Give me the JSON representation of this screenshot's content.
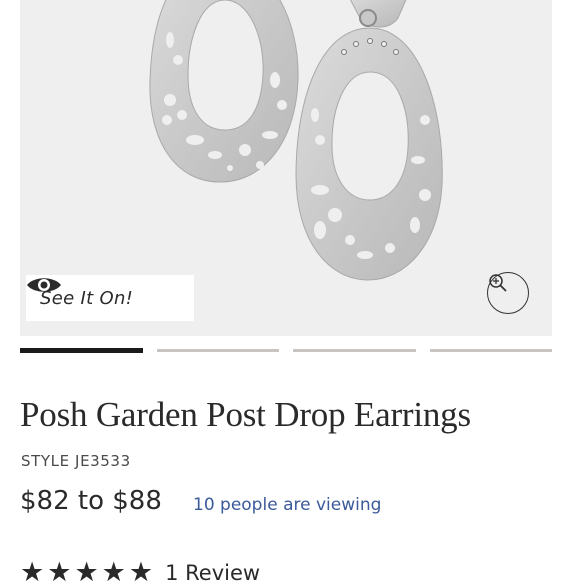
{
  "gallery": {
    "see_it_on_label": "See It On!",
    "active_index": 0,
    "indicator_count": 4
  },
  "product": {
    "title": "Posh Garden Post Drop Earrings",
    "style": "STYLE JE3533",
    "price": "$82 to $88",
    "viewing": "10 people are viewing",
    "rating_stars": 5,
    "reviews_label": "1 Review"
  },
  "colors": {
    "accent_blue": "#3b5a9a",
    "text_dark": "#2a2a2a",
    "hero_bg": "#efefef"
  }
}
